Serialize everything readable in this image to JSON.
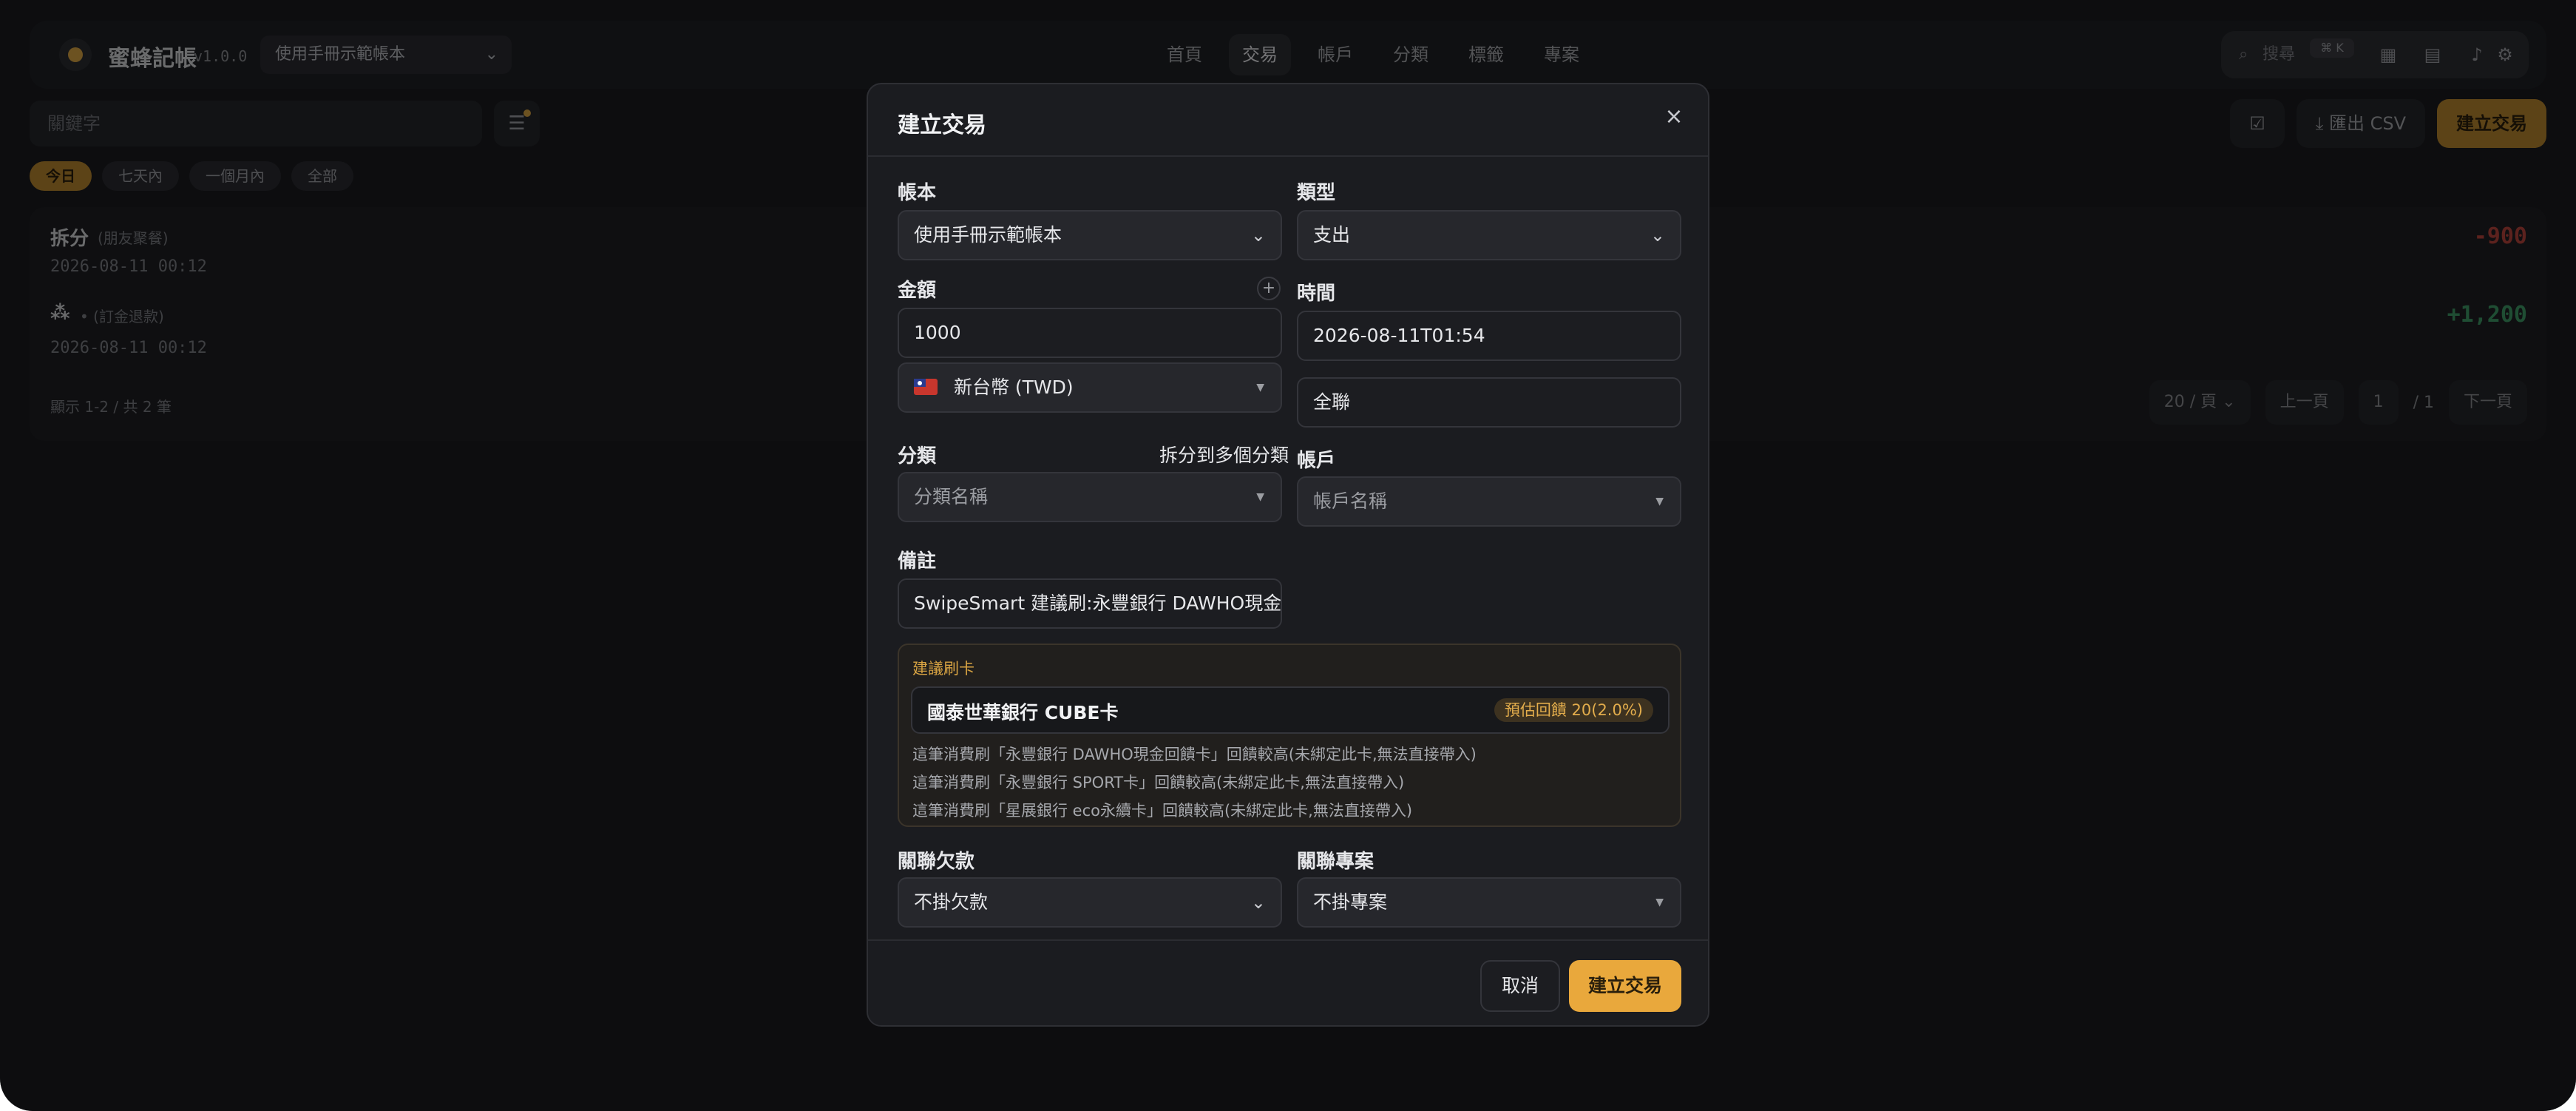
{
  "app": {
    "name": "蜜蜂記帳",
    "version": "v1.0.0",
    "book_selector": "使用手冊示範帳本"
  },
  "nav": {
    "tabs": [
      {
        "label": "首頁"
      },
      {
        "label": "交易"
      },
      {
        "label": "帳戶"
      },
      {
        "label": "分類"
      },
      {
        "label": "標籤"
      },
      {
        "label": "專案"
      }
    ],
    "active": "交易"
  },
  "top_tools": {
    "search_placeholder": "搜尋",
    "search_shortcut": "⌘ K"
  },
  "toolbar": {
    "keyword_placeholder": "關鍵字",
    "export_label": "匯出 CSV",
    "create_label": "建立交易"
  },
  "date_filters": [
    {
      "label": "今日"
    },
    {
      "label": "七天內"
    },
    {
      "label": "一個月內"
    },
    {
      "label": "全部"
    }
  ],
  "transactions": [
    {
      "title": "拆分",
      "sub": "(朋友聚餐)",
      "date": "2026-08-11 00:12",
      "amount": "-900"
    },
    {
      "title": "",
      "sub": "• (訂金退款)",
      "date": "2026-08-11 00:12",
      "amount": "+1,200"
    }
  ],
  "pagination": {
    "info": "顯示 1-2 / 共 2 筆",
    "page_size": "20 / 頁",
    "prev": "上一頁",
    "current": "1",
    "total": "/ 1",
    "next": "下一頁"
  },
  "modal": {
    "title": "建立交易",
    "book_label": "帳本",
    "book_value": "使用手冊示範帳本",
    "type_label": "類型",
    "type_value": "支出",
    "amount_label": "金額",
    "amount_value": "1000",
    "currency_value": "新台幣 (TWD)",
    "time_label": "時間",
    "time_value": "2026-08-11T01:54",
    "merchant_value": "全聯",
    "category_label": "分類",
    "split_label": "拆分到多個分類",
    "category_placeholder": "分類名稱",
    "account_label": "帳戶",
    "account_placeholder": "帳戶名稱",
    "note_label": "備註",
    "note_value": "SwipeSmart 建議刷:永豐銀行 DAWHO現金回饋卡",
    "suggestion": {
      "title": "建議刷卡",
      "card_name": "國泰世華銀行 CUBE卡",
      "badge": "預估回饋 20(2.0%)",
      "hints": [
        "這筆消費刷「永豐銀行 DAWHO現金回饋卡」回饋較高(未綁定此卡,無法直接帶入)",
        "這筆消費刷「永豐銀行 SPORT卡」回饋較高(未綁定此卡,無法直接帶入)",
        "這筆消費刷「星展銀行 eco永續卡」回饋較高(未綁定此卡,無法直接帶入)"
      ]
    },
    "debt_label": "關聯欠款",
    "debt_value": "不掛欠款",
    "project_label": "關聯專案",
    "project_value": "不掛專案",
    "cancel_label": "取消",
    "submit_label": "建立交易"
  },
  "colors": {
    "accent": "#e9a83c",
    "negative": "#b9443c",
    "positive": "#3f9a67"
  }
}
